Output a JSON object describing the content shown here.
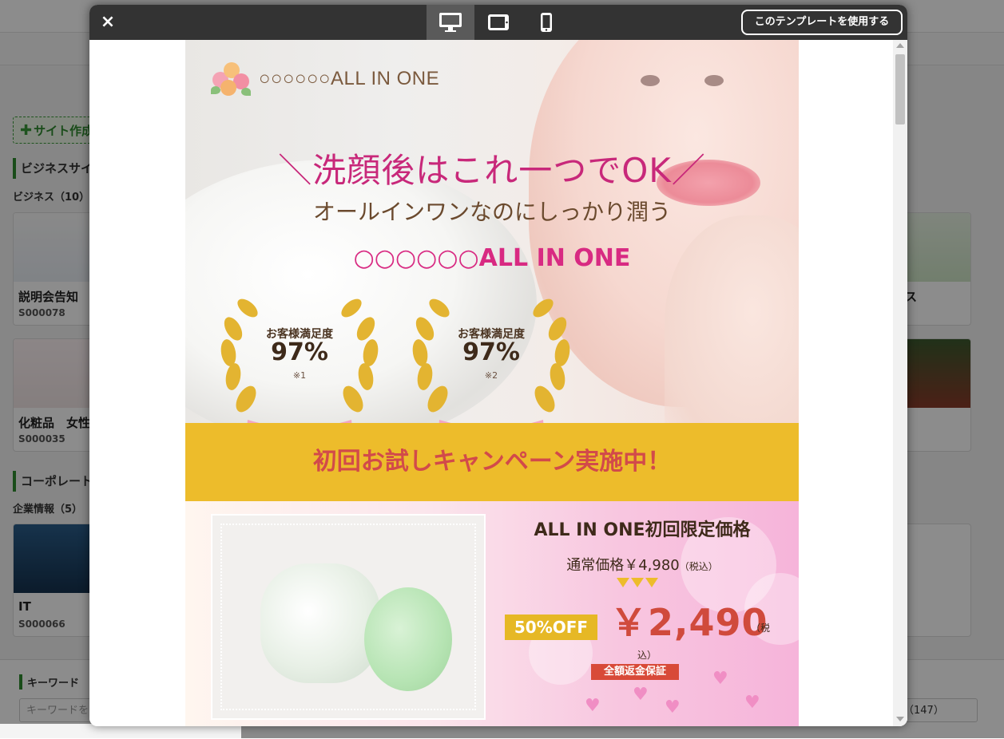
{
  "background": {
    "create_button": "サイト作成",
    "section1_title": "ビジネスサイト",
    "section1_sub": "ビジネス（10）",
    "cards": [
      {
        "name": "説明会告知",
        "code": "S000078"
      },
      {
        "name": "化粧品　女性",
        "code": "S000035"
      },
      {
        "name": "IT",
        "code": "S000066"
      }
    ],
    "right_card_text": "ス",
    "section2_title": "コーポレート",
    "section2_sub": "企業情報（5）",
    "search": {
      "label": "キーワード",
      "placeholder": "キーワードを",
      "select_value": "（147）"
    }
  },
  "modal": {
    "close_icon": "×",
    "use_template_button": "このテンプレートを使用する",
    "device_buttons": [
      "desktop-icon",
      "tablet-icon",
      "mobile-icon"
    ],
    "active_device": "desktop"
  },
  "landing": {
    "logo_text": "○○○○○○ALL IN ONE",
    "headline": "＼洗顔後はこれ一つでOK／",
    "subheadline": "オールインワンなのにしっかり潤う",
    "product_name": "○○○○○○ALL IN ONE",
    "awards": [
      {
        "label": "お客様満足度",
        "value": "97%",
        "note": "※1"
      },
      {
        "label": "お客様満足度",
        "value": "97%",
        "note": "※2"
      }
    ],
    "campaign": "初回お試しキャンペーン実施中！",
    "offer": {
      "title": "ALL IN ONE初回限定価格",
      "regular_price": "通常価格￥4,980",
      "regular_tax": "（税込）",
      "discount": "50%OFF",
      "price": "￥2,490",
      "tax_part1": "（税",
      "tax_part2": "込）",
      "guarantee": "全額返金保証"
    },
    "colors": {
      "headline": "#c8287a",
      "campaign_band": "#edbc2b",
      "price": "#d04a3c"
    }
  }
}
